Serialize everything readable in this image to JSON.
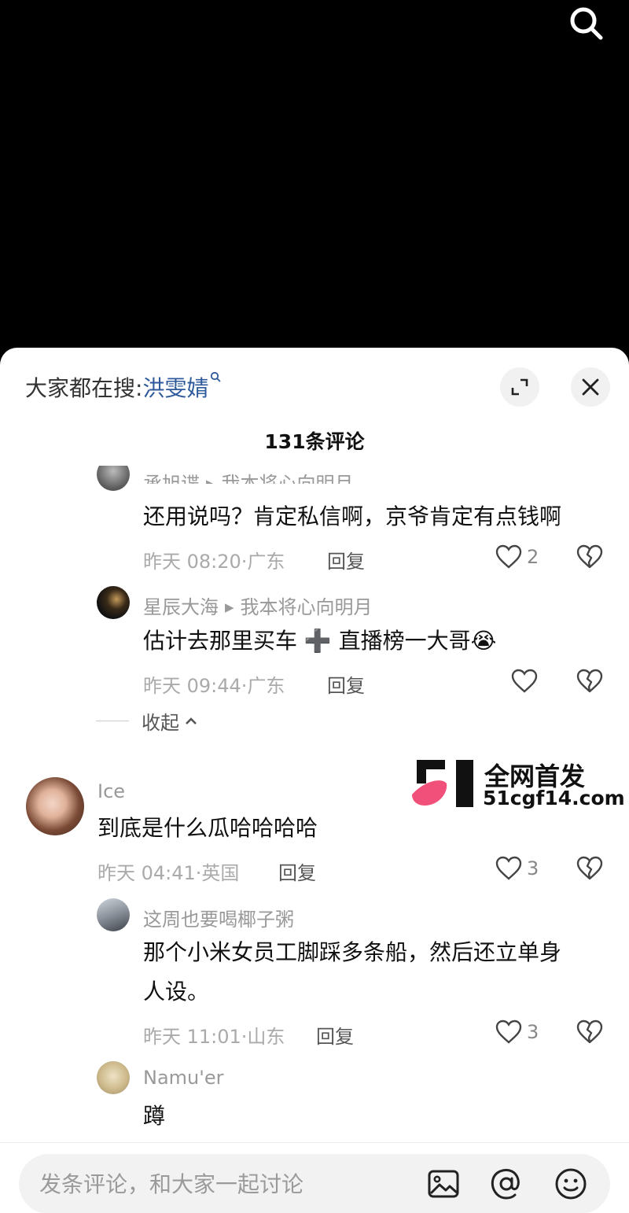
{
  "hot_search": {
    "label": "大家都在搜:",
    "keyword": "洪雯婧"
  },
  "comment_count": "131条评论",
  "comments": [
    {
      "name": "承旭谍",
      "reply_to": "我本将心向明月",
      "text": "还用说吗？肯定私信啊，京爷肯定有点钱啊",
      "time": "昨天 08:20·广东",
      "reply": "回复",
      "likes": "2"
    },
    {
      "name": "星辰大海",
      "reply_to": "我本将心向明月",
      "text": "估计去那里买车 ➕ 直播榜一大哥😭",
      "time": "昨天 09:44·广东",
      "reply": "回复",
      "likes": ""
    },
    {
      "name": "Ice",
      "text": "到底是什么瓜哈哈哈哈",
      "time": "昨天 04:41·英国",
      "reply": "回复",
      "likes": "3"
    },
    {
      "name": "这周也要喝椰子粥",
      "text_line1": "那个小米女员工脚踩多条船，然后还立单身",
      "text_line2": "人设。",
      "time": "昨天 11:01·山东",
      "reply": "回复",
      "likes": "3"
    },
    {
      "name": "Namu'er",
      "text": "蹲"
    }
  ],
  "collapse_label": "收起",
  "watermark": {
    "line1": "全网首发",
    "line2": "51cgf14.com"
  },
  "input": {
    "placeholder": "发条评论，和大家一起讨论"
  },
  "icons": {
    "top_search": "search-icon",
    "expand": "expand-icon",
    "close": "close-icon",
    "like": "heart-icon",
    "dislike": "broken-heart-icon",
    "image": "image-icon",
    "mention": "at-icon",
    "emoji": "emoji-icon"
  },
  "colors": {
    "keyword": "#2e5a9c",
    "watermark_pink": "#f0507a"
  }
}
